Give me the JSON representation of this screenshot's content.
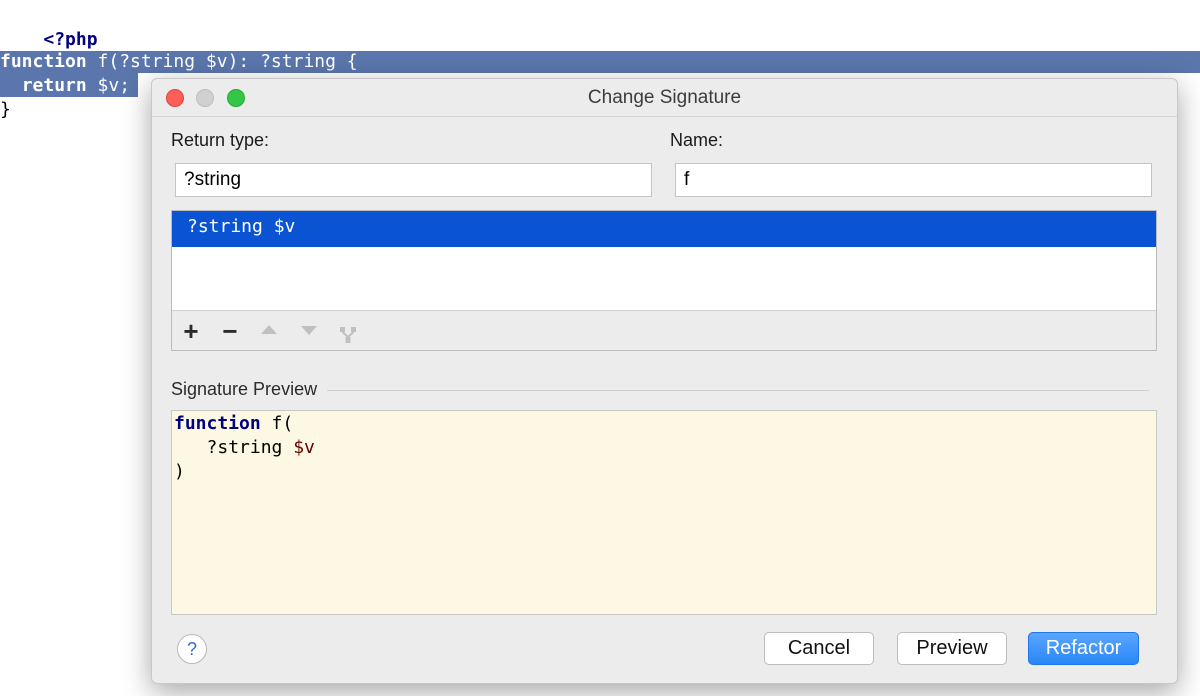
{
  "editor": {
    "open_tag": "<?php",
    "line1_keyword": "function",
    "line1_rest": " f(?string $v): ?string {",
    "line2_indent": "  ",
    "line2_keyword": "return",
    "line2_rest": " $v;",
    "line3": "}",
    "selection_color": "#5a76ac"
  },
  "dialog": {
    "title": "Change Signature",
    "return_type_label": "Return type:",
    "return_type_value": "?string",
    "name_label": "Name:",
    "name_value": "f",
    "parameters": [
      {
        "text": "?string $v",
        "selected": true
      }
    ],
    "toolbar": {
      "add": "+",
      "remove": "−"
    },
    "preview_label": "Signature Preview",
    "preview": {
      "line1_keyword": "function",
      "line1_rest": " f(",
      "line2_indent": "   ",
      "line2_type": "?string ",
      "line2_var": "$v",
      "line3": ")"
    },
    "help_label": "?",
    "cancel_label": "Cancel",
    "preview_button_label": "Preview",
    "refactor_label": "Refactor",
    "accent_color": "#0a54d3"
  }
}
